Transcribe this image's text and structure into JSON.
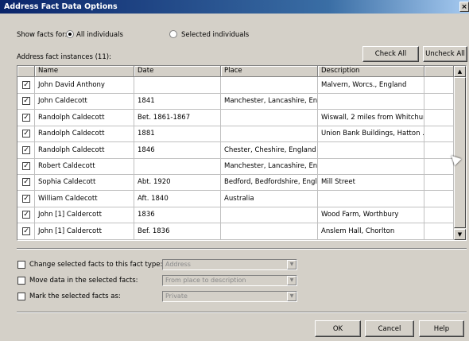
{
  "window": {
    "title": "Address Fact Data Options",
    "close_label": "×"
  },
  "show_facts": {
    "label": "Show facts for:",
    "options": [
      {
        "label": "All individuals",
        "selected": true
      },
      {
        "label": "Selected individuals",
        "selected": false
      }
    ]
  },
  "instances_label": "Address fact instances (11):",
  "buttons": {
    "check_all": "Check All",
    "uncheck_all": "Uncheck All",
    "ok": "OK",
    "cancel": "Cancel",
    "help": "Help"
  },
  "table": {
    "columns": [
      "",
      "Name",
      "Date",
      "Place",
      "Description",
      ""
    ],
    "rows": [
      {
        "checked": true,
        "check_mark": "✓",
        "name": "John David Anthony",
        "date": "",
        "place": "",
        "description": "Malvern, Worcs., England"
      },
      {
        "checked": true,
        "check_mark": "✓",
        "name": "John Caldecott",
        "date": "1841",
        "place": "Manchester, Lancashire, En...",
        "description": ""
      },
      {
        "checked": true,
        "check_mark": "✓",
        "name": "Randolph Caldecott",
        "date": "Bet. 1861-1867",
        "place": "",
        "description": "Wiswall, 2 miles from Whitchur..."
      },
      {
        "checked": true,
        "check_mark": "✓",
        "name": "Randolph Caldecott",
        "date": "1881",
        "place": "",
        "description": "Union Bank Buildings, Hatton ..."
      },
      {
        "checked": true,
        "check_mark": "✓",
        "name": "Randolph Caldecott",
        "date": "1846",
        "place": "Chester, Cheshire, England",
        "description": ""
      },
      {
        "checked": true,
        "check_mark": "✓",
        "name": "Robert Caldecott",
        "date": "",
        "place": "Manchester, Lancashire, En...",
        "description": ""
      },
      {
        "checked": true,
        "check_mark": "✓",
        "name": "Sophia Caldecott",
        "date": "Abt. 1920",
        "place": "Bedford, Bedfordshire, Engl...",
        "description": "Mill Street"
      },
      {
        "checked": true,
        "check_mark": "✓",
        "name": "William Caldecott",
        "date": "Aft. 1840",
        "place": "Australia",
        "description": ""
      },
      {
        "checked": true,
        "check_mark": "✓",
        "name": "John [1] Caldercott",
        "date": "1836",
        "place": "",
        "description": "Wood Farm, Worthbury"
      },
      {
        "checked": true,
        "check_mark": "✓",
        "name": "John [1] Caldercott",
        "date": "Bef. 1836",
        "place": "",
        "description": "Anslem Hall, Chorlton"
      }
    ]
  },
  "scroll": {
    "up": "▲",
    "down": "▼"
  },
  "options": [
    {
      "label": "Change selected facts to this fact type:",
      "checked": false,
      "value": "Address"
    },
    {
      "label": "Move data in the selected facts:",
      "checked": false,
      "value": "From place to description"
    },
    {
      "label": "Mark the selected facts as:",
      "checked": false,
      "value": "Private"
    }
  ],
  "combo_arrow": "▼"
}
